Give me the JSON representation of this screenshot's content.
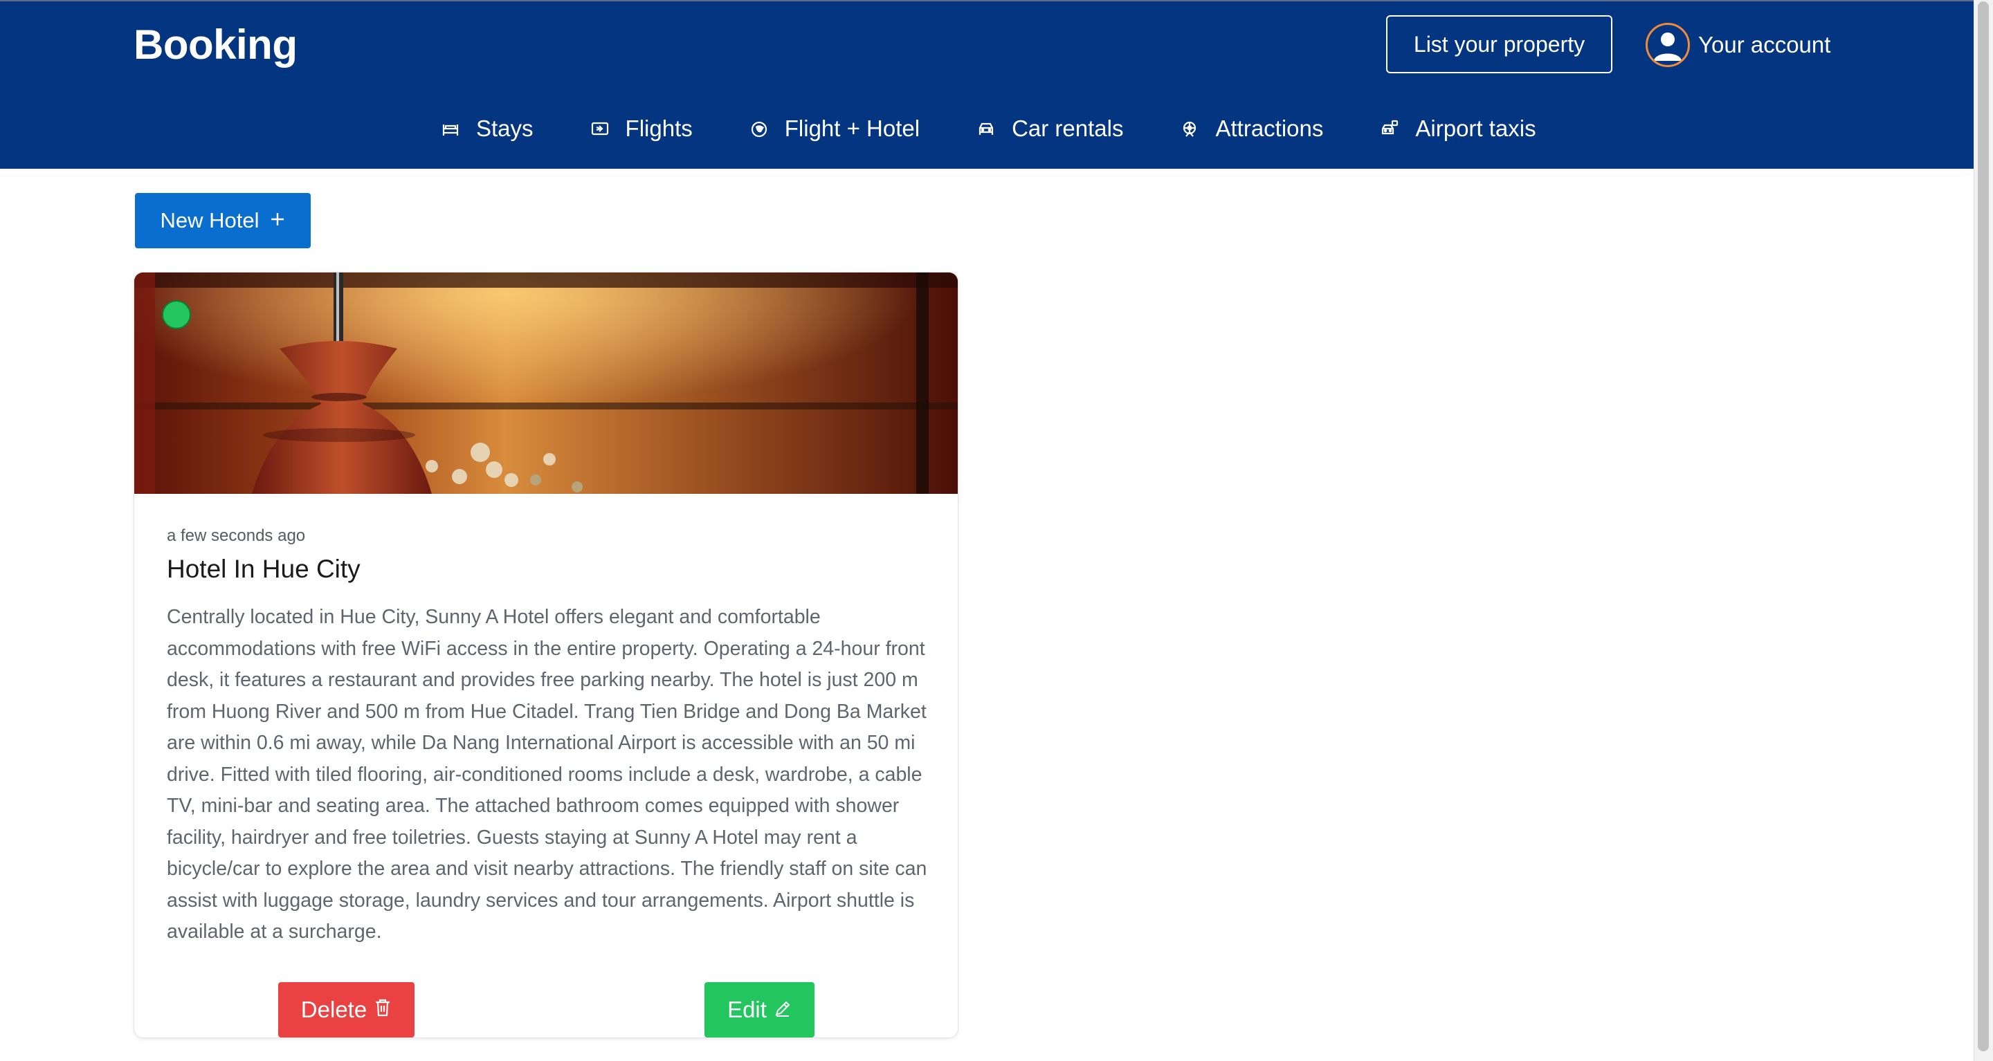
{
  "header": {
    "logo": "Booking",
    "list_property": "List your property",
    "account_label": "Your account",
    "nav": [
      {
        "label": "Stays",
        "icon": "bed-icon"
      },
      {
        "label": "Flights",
        "icon": "plane-ticket-icon"
      },
      {
        "label": "Flight + Hotel",
        "icon": "globe-plane-icon"
      },
      {
        "label": "Car rentals",
        "icon": "car-icon"
      },
      {
        "label": "Attractions",
        "icon": "ferris-wheel-icon"
      },
      {
        "label": "Airport taxis",
        "icon": "taxi-icon"
      }
    ]
  },
  "toolbar": {
    "new_hotel_label": "New Hotel",
    "new_hotel_icon": "plus-icon"
  },
  "hotel_card": {
    "status": "active",
    "status_color": "#22c55e",
    "timestamp": "a few seconds ago",
    "name": "Hotel In Hue City",
    "description": "Centrally located in Hue City, Sunny A Hotel offers elegant and comfortable accommodations with free WiFi access in the entire property. Operating a 24-hour front desk, it features a restaurant and provides free parking nearby. The hotel is just 200 m from Huong River and 500 m from Hue Citadel. Trang Tien Bridge and Dong Ba Market are within 0.6 mi away, while Da Nang International Airport is accessible with an 50 mi drive. Fitted with tiled flooring, air-conditioned rooms include a desk, wardrobe, a cable TV, mini-bar and seating area. The attached bathroom comes equipped with shower facility, hairdryer and free toiletries. Guests staying at Sunny A Hotel may rent a bicycle/car to explore the area and visit nearby attractions. The friendly staff on site can assist with luggage storage, laundry services and tour arrangements. Airport shuttle is available at a surcharge.",
    "delete_label": "Delete",
    "edit_label": "Edit"
  },
  "colors": {
    "header_bg": "#033580",
    "primary_button": "#0a6ecf",
    "delete_button": "#ea4242",
    "edit_button": "#22c55e",
    "avatar_ring": "#f08b3a"
  }
}
